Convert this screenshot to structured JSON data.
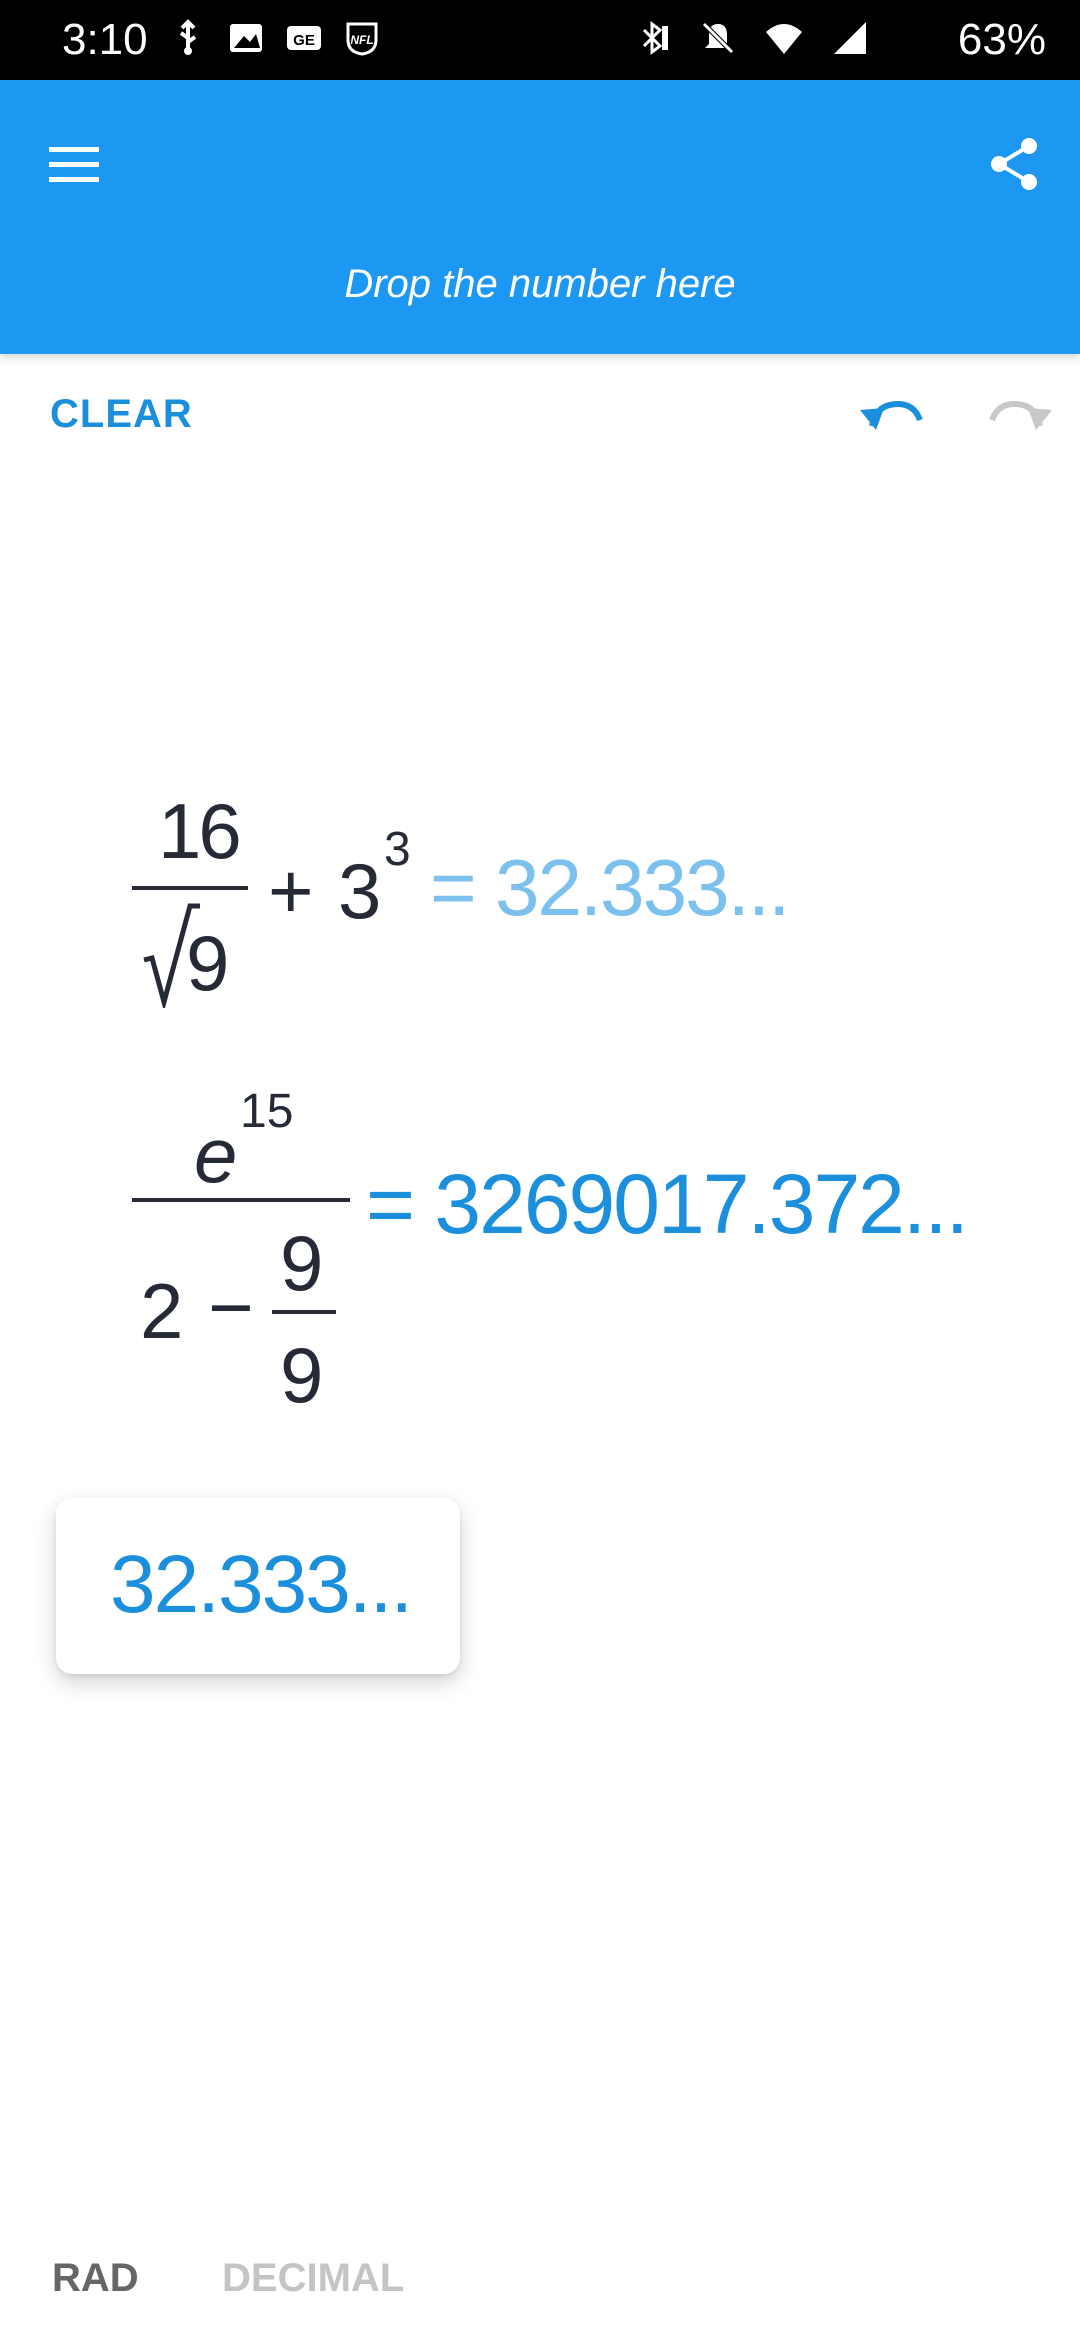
{
  "status_bar": {
    "time": "3:10",
    "battery": "63%",
    "left_icons": [
      "usb-icon",
      "image-icon",
      "ge-icon",
      "nfl-icon"
    ],
    "right_icons": [
      "bluetooth-icon",
      "mute-icon",
      "wifi-icon",
      "signal-icon"
    ]
  },
  "app_bar": {
    "drop_label": "Drop the number here",
    "color": "#1c98f2"
  },
  "toolbar": {
    "clear_label": "CLEAR"
  },
  "expressions": [
    {
      "numerator": "16",
      "sqrt_radicand": "9",
      "plus": "+",
      "base": "3",
      "exponent": "3",
      "result": "= 32.333..."
    },
    {
      "e": "e",
      "e_exponent": "15",
      "two": "2",
      "minus": "−",
      "inner_num": "9",
      "inner_den": "9",
      "result": "= 3269017.372..."
    }
  ],
  "drag_card": {
    "value": "32.333..."
  },
  "bottom": {
    "angle_mode": "RAD",
    "number_mode": "DECIMAL"
  },
  "colors": {
    "accent": "#1c8fdc",
    "faded_result": "#7cc0ee",
    "text": "#252a36"
  }
}
